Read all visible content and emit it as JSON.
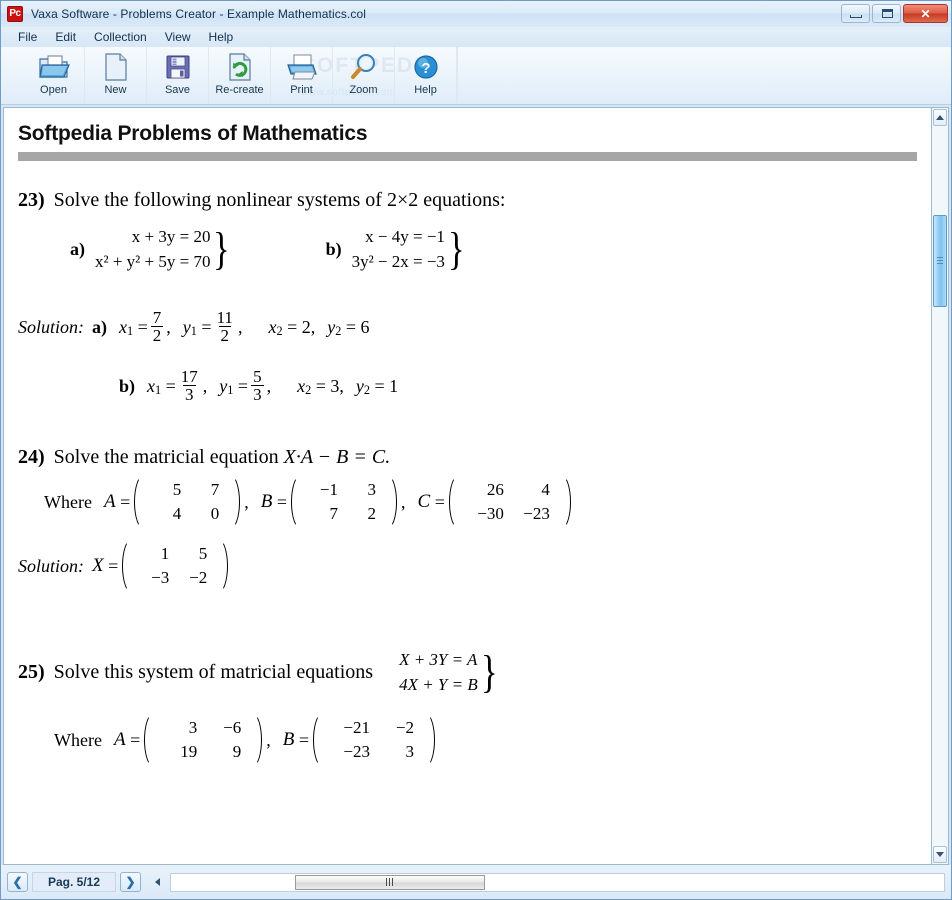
{
  "window": {
    "app_icon_text": "Pc",
    "title": "Vaxa Software - Problems Creator  -  Example Mathematics.col",
    "buttons": {
      "minimize": "minimize-button",
      "maximize": "maximize-button",
      "close": "✕"
    }
  },
  "menubar": {
    "items": [
      {
        "label": "File"
      },
      {
        "label": "Edit"
      },
      {
        "label": "Collection"
      },
      {
        "label": "View"
      },
      {
        "label": "Help"
      }
    ]
  },
  "toolbar": {
    "buttons": [
      {
        "label": "Open",
        "icon": "open-folder-icon"
      },
      {
        "label": "New",
        "icon": "new-document-icon"
      },
      {
        "label": "Save",
        "icon": "floppy-disk-icon"
      },
      {
        "label": "Re-create",
        "icon": "refresh-document-icon"
      },
      {
        "label": "Print",
        "icon": "printer-icon"
      },
      {
        "label": "Zoom",
        "icon": "magnifier-icon"
      },
      {
        "label": "Help",
        "icon": "question-mark-icon"
      }
    ],
    "watermark_line1": "SOFTPEDIA",
    "watermark_line2": "www.softpedia.com"
  },
  "document": {
    "title": "Softpedia Problems of Mathematics",
    "problems": [
      {
        "number": "23)",
        "statement_pre": "Solve the following nonlinear systems of ",
        "statement_math": "2×2",
        "statement_post": " equations:",
        "systems": [
          {
            "label": "a)",
            "equations": [
              "x + 3y = 20",
              "x² + y² + 5y = 70"
            ]
          },
          {
            "label": "b)",
            "equations": [
              "x − 4y = −1",
              "3y² − 2x = −3"
            ]
          }
        ],
        "solution_word": "Solution:",
        "solutions": [
          {
            "label": "a)",
            "x1_num": "7",
            "x1_den": "2",
            "y1_num": "11",
            "y1_den": "2",
            "x2": "2",
            "y2": "6"
          },
          {
            "label": "b)",
            "x1_num": "17",
            "x1_den": "3",
            "y1_num": "5",
            "y1_den": "3",
            "x2": "3",
            "y2": "1"
          }
        ]
      },
      {
        "number": "24)",
        "statement": "Solve the matricial equation ",
        "equation": "X·A − B = C.",
        "where_word": "Where",
        "matrices": [
          {
            "name": "A",
            "rows": [
              [
                "5",
                "7"
              ],
              [
                "4",
                "0"
              ]
            ],
            "sep": ","
          },
          {
            "name": "B",
            "rows": [
              [
                "−1",
                "3"
              ],
              [
                "7",
                "2"
              ]
            ],
            "sep": ","
          },
          {
            "name": "C",
            "rows": [
              [
                "26",
                "4"
              ],
              [
                "−30",
                "−23"
              ]
            ],
            "sep": ""
          }
        ],
        "solution_word": "Solution:",
        "solution_matrix": {
          "name": "X",
          "rows": [
            [
              "1",
              "5"
            ],
            [
              "−3",
              "−2"
            ]
          ]
        }
      },
      {
        "number": "25)",
        "statement": "Solve this system of matricial equations",
        "system": [
          "X + 3Y = A",
          "4X + Y = B"
        ],
        "where_word": "Where",
        "matrices": [
          {
            "name": "A",
            "rows": [
              [
                "3",
                "−6"
              ],
              [
                "19",
                "9"
              ]
            ],
            "sep": ","
          },
          {
            "name": "B",
            "rows": [
              [
                "−21",
                "−2"
              ],
              [
                "−23",
                "3"
              ]
            ],
            "sep": ""
          }
        ]
      }
    ]
  },
  "statusbar": {
    "prev_label": "❮",
    "page_label": "Pag. 5/12",
    "next_label": "❯"
  }
}
